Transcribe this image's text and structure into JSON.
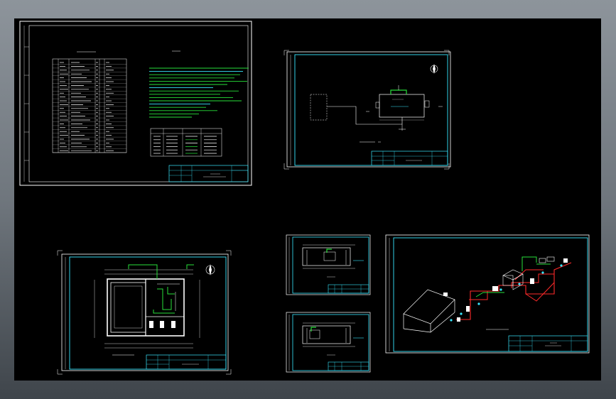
{
  "viewport": {
    "background": "#000000",
    "colors": {
      "frame": "#ffffff",
      "border_cyan": "#38e8ff",
      "pipe_green": "#27e03a",
      "pipe_red": "#ff2a2a",
      "text": "#ffffff"
    }
  },
  "sheets": [
    {
      "id": "sheet-notes",
      "description_label": "",
      "title_block": {
        "drawing_no": "",
        "title": ""
      }
    },
    {
      "id": "sheet-plan-small",
      "title_block": {
        "drawing_no": "",
        "title": ""
      }
    },
    {
      "id": "sheet-floor-plan",
      "title_block": {
        "drawing_no": "",
        "title": ""
      }
    },
    {
      "id": "sheet-section-a",
      "title_block": {
        "drawing_no": "",
        "title": ""
      }
    },
    {
      "id": "sheet-section-b",
      "title_block": {
        "drawing_no": "",
        "title": ""
      }
    },
    {
      "id": "sheet-isometric",
      "title_block": {
        "drawing_no": "",
        "title": ""
      }
    }
  ]
}
